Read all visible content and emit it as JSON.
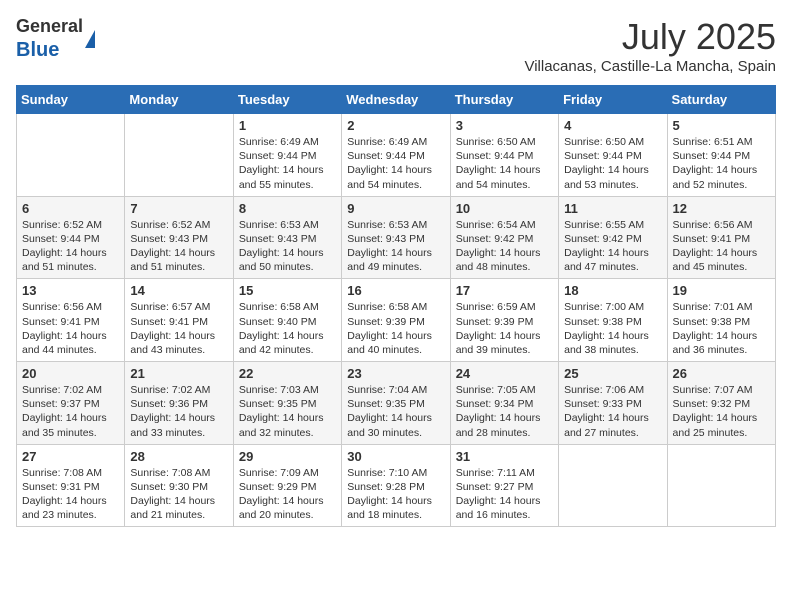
{
  "header": {
    "logo_general": "General",
    "logo_blue": "Blue",
    "month_year": "July 2025",
    "location": "Villacanas, Castille-La Mancha, Spain"
  },
  "days_of_week": [
    "Sunday",
    "Monday",
    "Tuesday",
    "Wednesday",
    "Thursday",
    "Friday",
    "Saturday"
  ],
  "weeks": [
    [
      {
        "day": "",
        "content": ""
      },
      {
        "day": "",
        "content": ""
      },
      {
        "day": "1",
        "content": "Sunrise: 6:49 AM\nSunset: 9:44 PM\nDaylight: 14 hours and 55 minutes."
      },
      {
        "day": "2",
        "content": "Sunrise: 6:49 AM\nSunset: 9:44 PM\nDaylight: 14 hours and 54 minutes."
      },
      {
        "day": "3",
        "content": "Sunrise: 6:50 AM\nSunset: 9:44 PM\nDaylight: 14 hours and 54 minutes."
      },
      {
        "day": "4",
        "content": "Sunrise: 6:50 AM\nSunset: 9:44 PM\nDaylight: 14 hours and 53 minutes."
      },
      {
        "day": "5",
        "content": "Sunrise: 6:51 AM\nSunset: 9:44 PM\nDaylight: 14 hours and 52 minutes."
      }
    ],
    [
      {
        "day": "6",
        "content": "Sunrise: 6:52 AM\nSunset: 9:44 PM\nDaylight: 14 hours and 51 minutes."
      },
      {
        "day": "7",
        "content": "Sunrise: 6:52 AM\nSunset: 9:43 PM\nDaylight: 14 hours and 51 minutes."
      },
      {
        "day": "8",
        "content": "Sunrise: 6:53 AM\nSunset: 9:43 PM\nDaylight: 14 hours and 50 minutes."
      },
      {
        "day": "9",
        "content": "Sunrise: 6:53 AM\nSunset: 9:43 PM\nDaylight: 14 hours and 49 minutes."
      },
      {
        "day": "10",
        "content": "Sunrise: 6:54 AM\nSunset: 9:42 PM\nDaylight: 14 hours and 48 minutes."
      },
      {
        "day": "11",
        "content": "Sunrise: 6:55 AM\nSunset: 9:42 PM\nDaylight: 14 hours and 47 minutes."
      },
      {
        "day": "12",
        "content": "Sunrise: 6:56 AM\nSunset: 9:41 PM\nDaylight: 14 hours and 45 minutes."
      }
    ],
    [
      {
        "day": "13",
        "content": "Sunrise: 6:56 AM\nSunset: 9:41 PM\nDaylight: 14 hours and 44 minutes."
      },
      {
        "day": "14",
        "content": "Sunrise: 6:57 AM\nSunset: 9:41 PM\nDaylight: 14 hours and 43 minutes."
      },
      {
        "day": "15",
        "content": "Sunrise: 6:58 AM\nSunset: 9:40 PM\nDaylight: 14 hours and 42 minutes."
      },
      {
        "day": "16",
        "content": "Sunrise: 6:58 AM\nSunset: 9:39 PM\nDaylight: 14 hours and 40 minutes."
      },
      {
        "day": "17",
        "content": "Sunrise: 6:59 AM\nSunset: 9:39 PM\nDaylight: 14 hours and 39 minutes."
      },
      {
        "day": "18",
        "content": "Sunrise: 7:00 AM\nSunset: 9:38 PM\nDaylight: 14 hours and 38 minutes."
      },
      {
        "day": "19",
        "content": "Sunrise: 7:01 AM\nSunset: 9:38 PM\nDaylight: 14 hours and 36 minutes."
      }
    ],
    [
      {
        "day": "20",
        "content": "Sunrise: 7:02 AM\nSunset: 9:37 PM\nDaylight: 14 hours and 35 minutes."
      },
      {
        "day": "21",
        "content": "Sunrise: 7:02 AM\nSunset: 9:36 PM\nDaylight: 14 hours and 33 minutes."
      },
      {
        "day": "22",
        "content": "Sunrise: 7:03 AM\nSunset: 9:35 PM\nDaylight: 14 hours and 32 minutes."
      },
      {
        "day": "23",
        "content": "Sunrise: 7:04 AM\nSunset: 9:35 PM\nDaylight: 14 hours and 30 minutes."
      },
      {
        "day": "24",
        "content": "Sunrise: 7:05 AM\nSunset: 9:34 PM\nDaylight: 14 hours and 28 minutes."
      },
      {
        "day": "25",
        "content": "Sunrise: 7:06 AM\nSunset: 9:33 PM\nDaylight: 14 hours and 27 minutes."
      },
      {
        "day": "26",
        "content": "Sunrise: 7:07 AM\nSunset: 9:32 PM\nDaylight: 14 hours and 25 minutes."
      }
    ],
    [
      {
        "day": "27",
        "content": "Sunrise: 7:08 AM\nSunset: 9:31 PM\nDaylight: 14 hours and 23 minutes."
      },
      {
        "day": "28",
        "content": "Sunrise: 7:08 AM\nSunset: 9:30 PM\nDaylight: 14 hours and 21 minutes."
      },
      {
        "day": "29",
        "content": "Sunrise: 7:09 AM\nSunset: 9:29 PM\nDaylight: 14 hours and 20 minutes."
      },
      {
        "day": "30",
        "content": "Sunrise: 7:10 AM\nSunset: 9:28 PM\nDaylight: 14 hours and 18 minutes."
      },
      {
        "day": "31",
        "content": "Sunrise: 7:11 AM\nSunset: 9:27 PM\nDaylight: 14 hours and 16 minutes."
      },
      {
        "day": "",
        "content": ""
      },
      {
        "day": "",
        "content": ""
      }
    ]
  ]
}
